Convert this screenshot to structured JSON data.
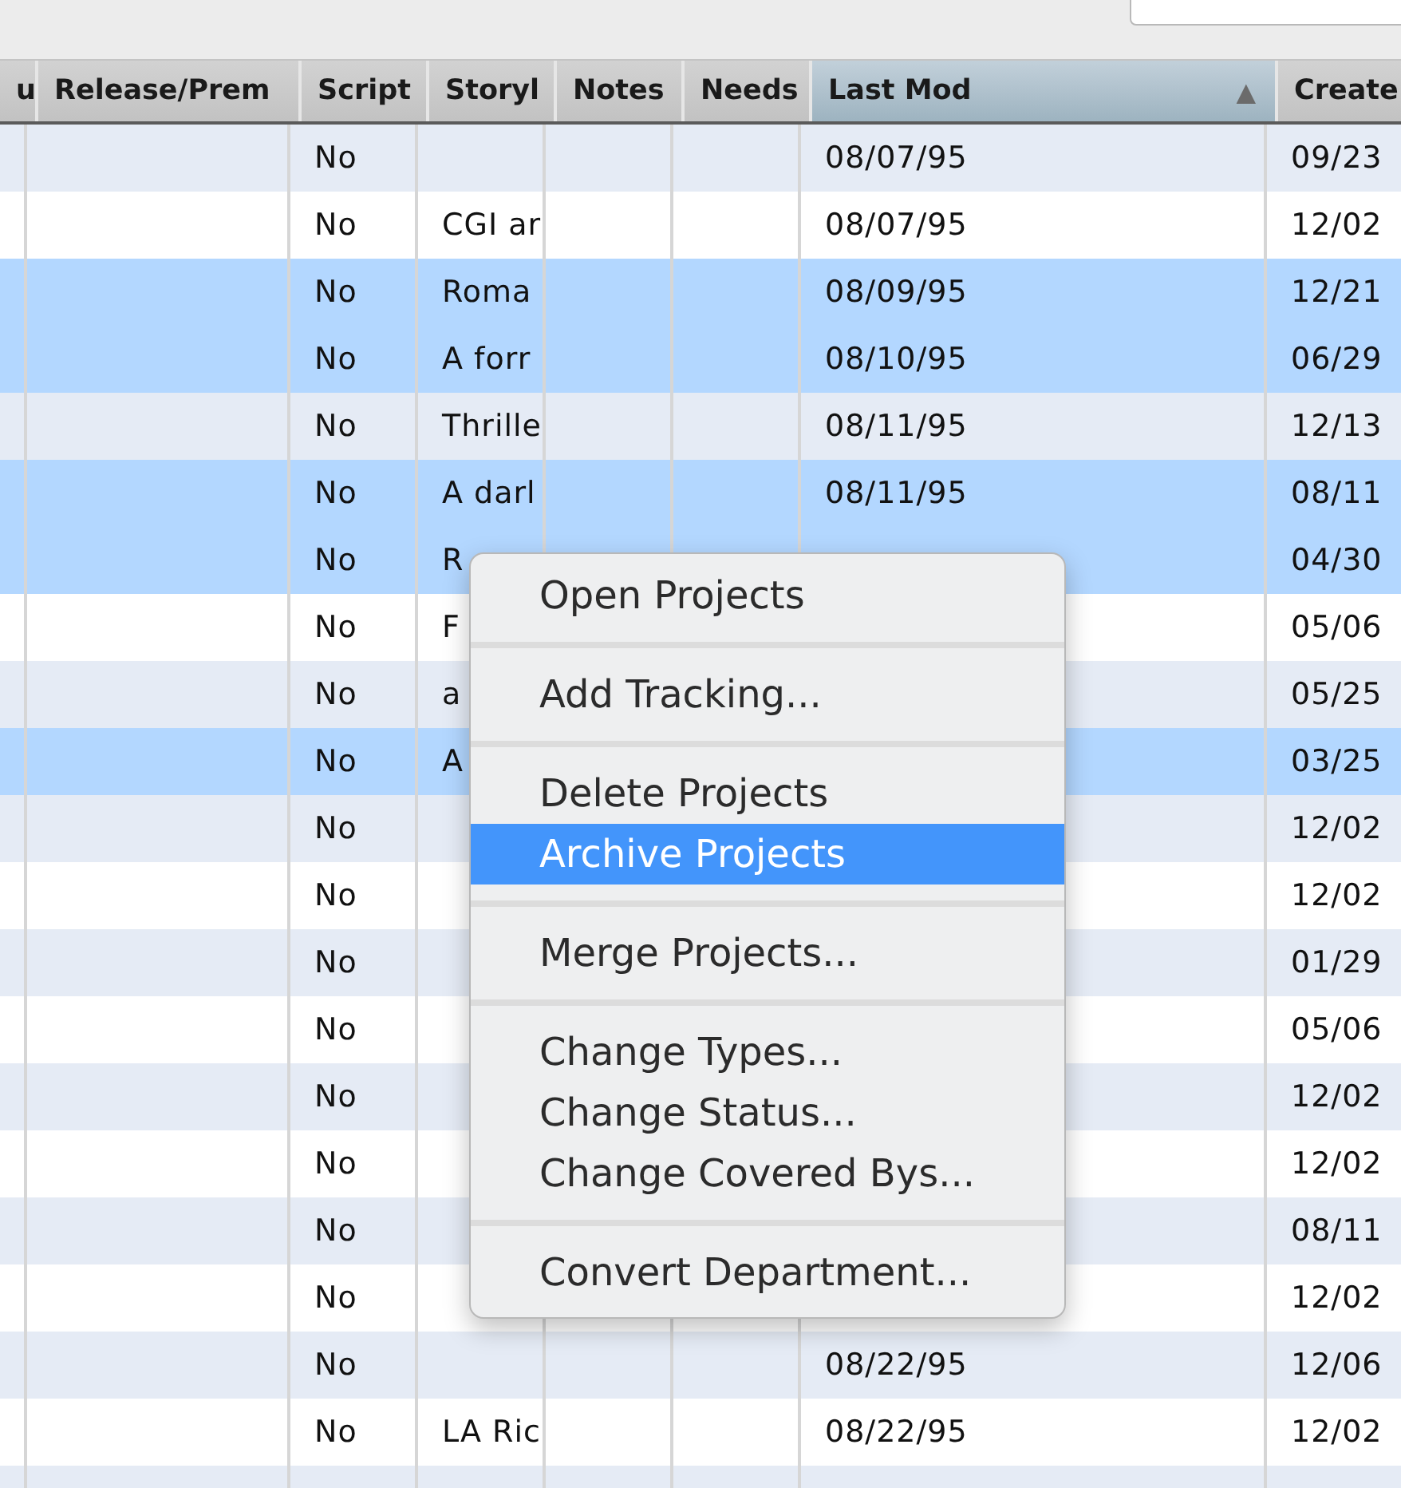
{
  "columns": [
    {
      "label": "u",
      "sorted": false
    },
    {
      "label": "Release/Prem",
      "sorted": false
    },
    {
      "label": "Script",
      "sorted": false
    },
    {
      "label": "Storyl",
      "sorted": false
    },
    {
      "label": "Notes",
      "sorted": false
    },
    {
      "label": "Needs",
      "sorted": false
    },
    {
      "label": "Last Mod",
      "sorted": true,
      "sort_indicator": "▲"
    },
    {
      "label": "Create",
      "sorted": false
    }
  ],
  "rows": [
    {
      "selected": false,
      "script": "No",
      "last_mod": "08/07/95",
      "created": "09/23"
    },
    {
      "selected": false,
      "script": "No",
      "storyline": "CGI ar",
      "last_mod": "08/07/95",
      "created": "12/02"
    },
    {
      "selected": true,
      "script": "No",
      "storyline": "Roma",
      "last_mod": "08/09/95",
      "created": "12/21"
    },
    {
      "selected": true,
      "script": "No",
      "storyline": "A forr",
      "last_mod": "08/10/95",
      "created": "06/29"
    },
    {
      "selected": false,
      "script": "No",
      "storyline": "Thrille",
      "last_mod": "08/11/95",
      "created": "12/13"
    },
    {
      "selected": true,
      "script": "No",
      "storyline": "A darl",
      "last_mod": "08/11/95",
      "created": "08/11"
    },
    {
      "selected": true,
      "script": "No",
      "storyline": "R",
      "created": "04/30"
    },
    {
      "selected": false,
      "script": "No",
      "storyline": "F",
      "created": "05/06"
    },
    {
      "selected": false,
      "script": "No",
      "storyline": "a",
      "created": "05/25"
    },
    {
      "selected": true,
      "script": "No",
      "storyline": "A",
      "created": "03/25"
    },
    {
      "selected": false,
      "script": "No",
      "created": "12/02"
    },
    {
      "selected": false,
      "script": "No",
      "created": "12/02"
    },
    {
      "selected": false,
      "script": "No",
      "created": "01/29"
    },
    {
      "selected": false,
      "script": "No",
      "created": "05/06"
    },
    {
      "selected": false,
      "script": "No",
      "created": "12/02"
    },
    {
      "selected": false,
      "script": "No",
      "created": "12/02"
    },
    {
      "selected": false,
      "script": "No",
      "created": "08/11"
    },
    {
      "selected": false,
      "script": "No",
      "created": "12/02"
    },
    {
      "selected": false,
      "script": "No",
      "last_mod": "08/22/95",
      "created": "12/06"
    },
    {
      "selected": false,
      "script": "No",
      "storyline": "LA Ric",
      "last_mod": "08/22/95",
      "created": "12/02"
    },
    {
      "selected": false
    }
  ],
  "context_menu": {
    "groups": [
      [
        {
          "label": "Open Projects",
          "selected": false
        }
      ],
      [
        {
          "label": "Add Tracking...",
          "selected": false
        }
      ],
      [
        {
          "label": "Delete Projects",
          "selected": false
        },
        {
          "label": "Archive Projects",
          "selected": true
        }
      ],
      [
        {
          "label": "Merge Projects...",
          "selected": false
        }
      ],
      [
        {
          "label": "Change Types...",
          "selected": false
        },
        {
          "label": "Change Status...",
          "selected": false
        },
        {
          "label": "Change Covered Bys...",
          "selected": false
        }
      ],
      [
        {
          "label": "Convert Department...",
          "selected": false
        }
      ]
    ]
  }
}
